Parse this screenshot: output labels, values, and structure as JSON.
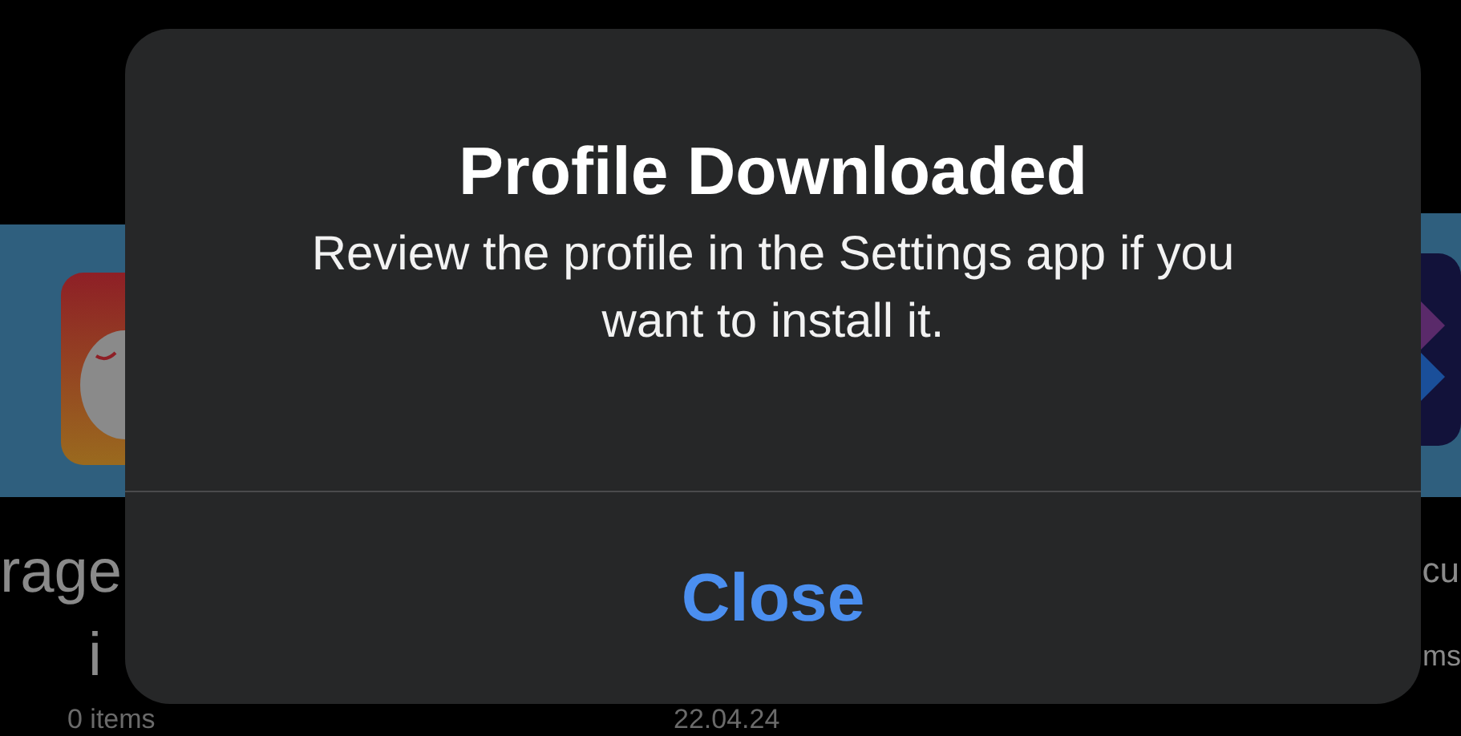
{
  "background": {
    "left_folder": {
      "label": "rage",
      "label_line_2": "i",
      "meta": "0 items"
    },
    "middle_folder": {
      "meta": "22.04.24"
    },
    "right_folder": {
      "label": "cu",
      "label_line_2": "ms"
    }
  },
  "alert": {
    "title": "Profile Downloaded",
    "message": "Review the profile in the Settings app if you want to install it.",
    "buttons": [
      {
        "label": "Close"
      }
    ]
  }
}
